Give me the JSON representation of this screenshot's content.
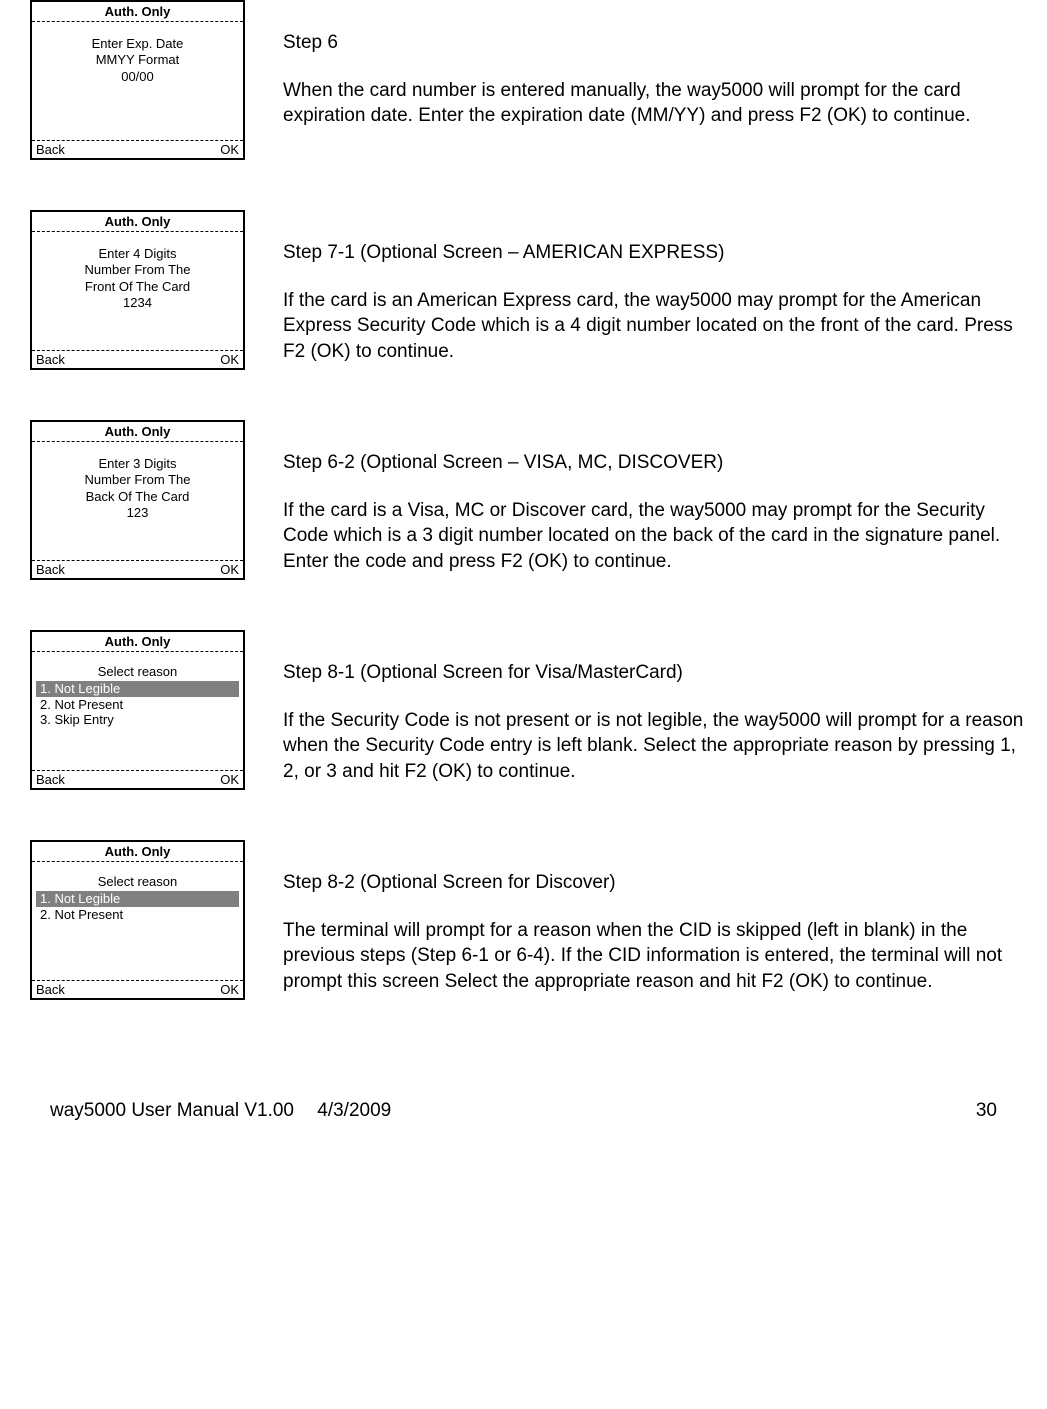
{
  "screens": [
    {
      "header": "Auth. Only",
      "lines": [
        "Enter Exp. Date",
        "MMYY Format",
        "00/00"
      ],
      "back": "Back",
      "ok": "OK"
    },
    {
      "header": "Auth. Only",
      "lines": [
        "Enter 4 Digits",
        "Number From The",
        "Front Of The Card",
        "1234"
      ],
      "back": "Back",
      "ok": "OK"
    },
    {
      "header": "Auth. Only",
      "lines": [
        "Enter 3 Digits",
        "Number From The",
        "Back Of The Card",
        "123"
      ],
      "back": "Back",
      "ok": "OK"
    },
    {
      "header": "Auth. Only",
      "select_label": "Select reason",
      "items": [
        {
          "text": "1. Not Legible",
          "selected": true
        },
        {
          "text": "2. Not Present",
          "selected": false
        },
        {
          "text": "3. Skip Entry",
          "selected": false
        }
      ],
      "back": "Back",
      "ok": "OK"
    },
    {
      "header": "Auth. Only",
      "select_label": "Select reason",
      "items": [
        {
          "text": "1. Not Legible",
          "selected": true
        },
        {
          "text": "2. Not Present",
          "selected": false
        }
      ],
      "back": "Back",
      "ok": "OK"
    }
  ],
  "steps": [
    {
      "title": "Step 6",
      "body": "When the card number is entered manually, the way5000 will prompt for the card expiration date. Enter the expiration date (MM/YY) and press F2 (OK) to continue."
    },
    {
      "title": "Step 7-1 (Optional Screen – AMERICAN EXPRESS)",
      "body": "If the card is an American Express card, the way5000 may prompt for the American Express Security Code which is a 4 digit number located on the front of the card. Press F2 (OK) to continue."
    },
    {
      "title": "Step 6-2 (Optional Screen – VISA, MC, DISCOVER)",
      "body": "If the card is a Visa, MC or Discover card, the way5000 may prompt for the Security Code which is a 3 digit number located on the back of the card in the signature panel. Enter the code and press F2 (OK) to continue."
    },
    {
      "title": "Step 8-1 (Optional Screen  for Visa/MasterCard)",
      "body": "If the Security Code is not present or is not legible, the way5000 will prompt for a reason when the Security Code entry is left blank. Select the appropriate reason by pressing 1, 2, or 3 and hit F2 (OK) to continue."
    },
    {
      "title": "Step 8-2 (Optional Screen  for Discover)",
      "body": "The terminal will prompt for a reason when the CID is skipped (left in blank) in the previous steps (Step 6-1 or 6-4). If the CID information is entered, the terminal will not prompt this screen Select the appropriate reason and hit F2 (OK) to continue."
    }
  ],
  "footer": {
    "manual": "way5000 User Manual V1.00",
    "date": "4/3/2009",
    "page": "30"
  }
}
